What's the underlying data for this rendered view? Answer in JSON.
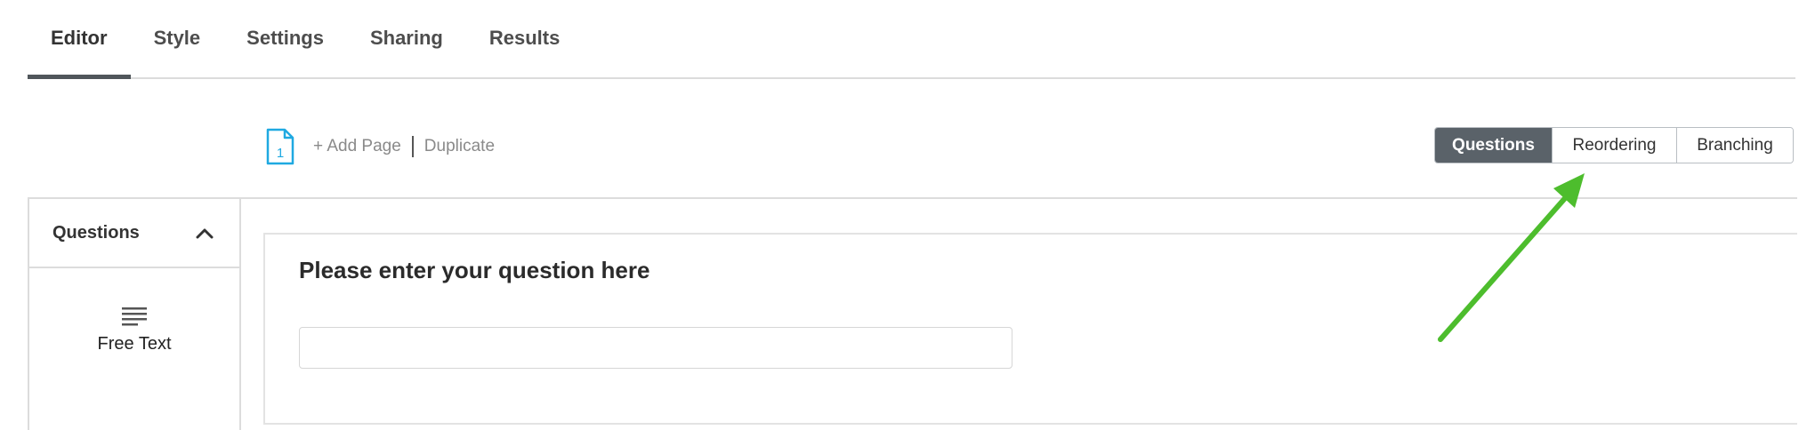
{
  "tabs": [
    {
      "label": "Editor",
      "active": true
    },
    {
      "label": "Style",
      "active": false
    },
    {
      "label": "Settings",
      "active": false
    },
    {
      "label": "Sharing",
      "active": false
    },
    {
      "label": "Results",
      "active": false
    }
  ],
  "page_toolbar": {
    "page_number": "1",
    "add_page_label": "+ Add Page",
    "duplicate_label": "Duplicate"
  },
  "view_modes": {
    "questions_label": "Questions",
    "reordering_label": "Reordering",
    "branching_label": "Branching",
    "active": "Questions"
  },
  "sidebar": {
    "title": "Questions",
    "collapse_icon": "chevron-up-icon",
    "items": [
      {
        "label": "Free Text",
        "icon": "text-lines-icon"
      }
    ]
  },
  "question": {
    "title": "Please enter your question here",
    "answer_value": ""
  },
  "colors": {
    "accent": "#5a6269",
    "page_icon": "#1fa9e1",
    "annotation_arrow": "#4dbd2d",
    "divider": "#dcdcdc"
  }
}
